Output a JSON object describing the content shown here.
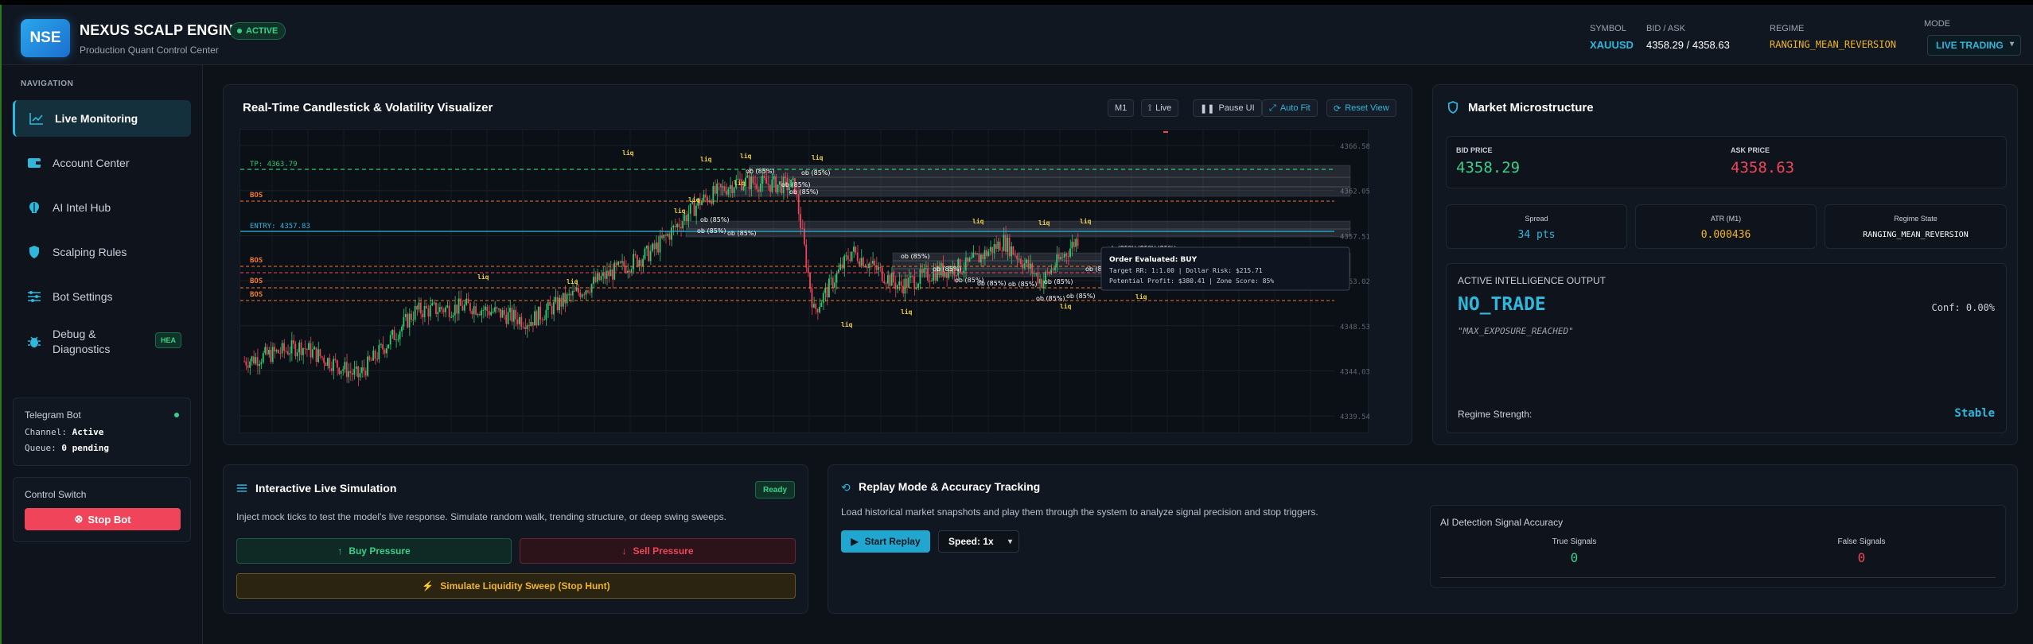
{
  "app": {
    "logo": "NSE",
    "title": "NEXUS SCALP ENGINE",
    "subtitle": "Production Quant Control Center",
    "status": "ACTIVE"
  },
  "header": {
    "symbol_label": "SYMBOL",
    "symbol": "XAUUSD",
    "bidask_label": "BID / ASK",
    "bidask": "4358.29 / 4358.63",
    "regime_label": "REGIME",
    "regime": "RANGING_MEAN_REVERSION",
    "mode_label": "MODE",
    "mode": "LIVE TRADING"
  },
  "nav": {
    "title": "NAVIGATION",
    "items": [
      {
        "label": "Live Monitoring",
        "icon": "chart-line-icon"
      },
      {
        "label": "Account Center",
        "icon": "wallet-icon"
      },
      {
        "label": "AI Intel Hub",
        "icon": "brain-icon"
      },
      {
        "label": "Scalping Rules",
        "icon": "shield-icon"
      },
      {
        "label": "Bot Settings",
        "icon": "sliders-icon"
      },
      {
        "label": "Debug &",
        "label2": "Diagnostics",
        "icon": "bug-icon",
        "badge": "HEA"
      }
    ]
  },
  "telegram": {
    "title": "Telegram Bot",
    "channel_label": "Channel:",
    "channel": "Active",
    "queue_label": "Queue:",
    "queue": "0 pending"
  },
  "control": {
    "title": "Control Switch",
    "stop": "Stop Bot"
  },
  "chart_panel": {
    "title": "Real-Time Candlestick & Volatility Visualizer",
    "buttons": {
      "timeframe": "M1",
      "live": "Live",
      "pause": "Pause UI",
      "autofit": "Auto Fit",
      "reset": "Reset View"
    }
  },
  "chart_data": {
    "type": "candlestick",
    "price_ticks": [
      "4366.58",
      "4362.05",
      "4357.51",
      "4353.02",
      "4348.53",
      "4344.03",
      "4339.54"
    ],
    "levels": {
      "tp": "TP: 4363.79",
      "entry": "ENTRY: 4357.83"
    },
    "labels": {
      "bos": "BOS",
      "liq": "liq",
      "ob": "ob (85%)"
    },
    "tooltip": {
      "title": "Order Evaluated: BUY",
      "line1": "Target RR: 1:1.00 | Dollar Risk: $215.71",
      "line2": "Potential Profit: $380.41 | Zone Score: 85%"
    }
  },
  "micro": {
    "title": "Market Microstructure",
    "bid_label": "BID PRICE",
    "bid": "4358.29",
    "ask_label": "ASK PRICE",
    "ask": "4358.63",
    "spread_label": "Spread",
    "spread": "34 pts",
    "atr_label": "ATR (M1)",
    "atr": "0.000436",
    "regime_label": "Regime State",
    "regime": "RANGING_MEAN_REVERSION",
    "intel_label": "ACTIVE INTELLIGENCE OUTPUT",
    "signal": "NO_TRADE",
    "conf": "Conf: 0.00%",
    "reason": "\"MAX_EXPOSURE_REACHED\"",
    "strength_label": "Regime Strength:",
    "strength": "Stable"
  },
  "sim": {
    "title": "Interactive Live Simulation",
    "status": "Ready",
    "desc": "Inject mock ticks to test the model's live response. Simulate random walk, trending structure, or deep swing sweeps.",
    "buy": "Buy Pressure",
    "sell": "Sell Pressure",
    "sweep": "Simulate Liquidity Sweep (Stop Hunt)"
  },
  "replay": {
    "title": "Replay Mode & Accuracy Tracking",
    "desc": "Load historical market snapshots and play them through the system to analyze signal precision and stop triggers.",
    "start": "Start Replay",
    "speed": "Speed: 1x",
    "acc_title": "AI Detection Signal Accuracy",
    "true_label": "True Signals",
    "true_val": "0",
    "false_label": "False Signals",
    "false_val": "0"
  },
  "colors": {
    "accent": "#2fb7dc",
    "green": "#37d18a",
    "red": "#f0445a",
    "amber": "#f0b429"
  }
}
